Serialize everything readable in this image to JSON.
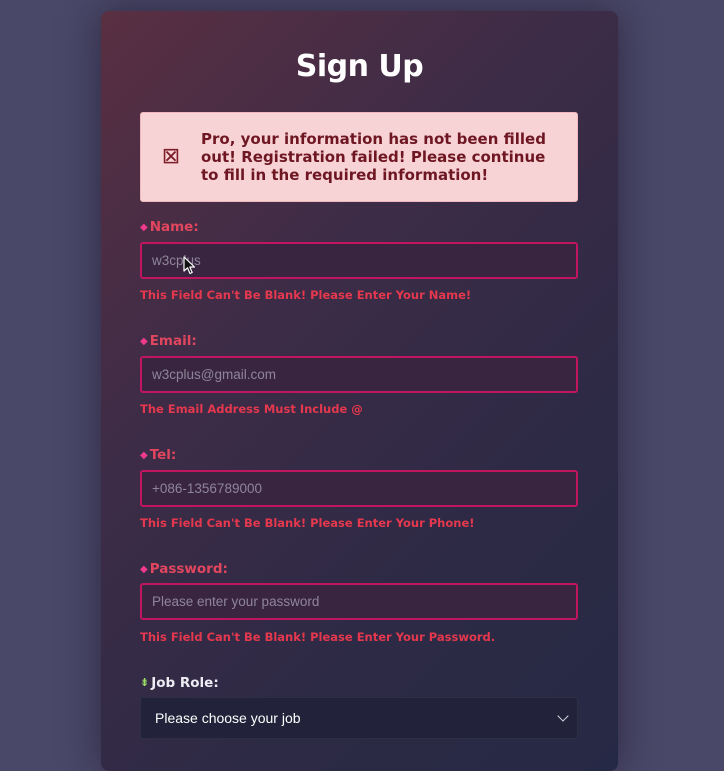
{
  "form": {
    "title": "Sign Up",
    "alert": {
      "icon": "close-box-icon",
      "message": "Pro, your information has not been filled out! Registration failed! Please continue to fill in the required information!"
    },
    "fields": {
      "name": {
        "label": "Name:",
        "marker": "◆",
        "placeholder": "w3cplus",
        "value": "",
        "error": "This Field Can't Be Blank! Please Enter Your Name!"
      },
      "email": {
        "label": "Email:",
        "marker": "◆",
        "placeholder": "w3cplus@gmail.com",
        "value": "",
        "error": "The Email Address Must Include @"
      },
      "tel": {
        "label": "Tel:",
        "marker": "◆",
        "placeholder": "+086-1356789000",
        "value": "",
        "error": "This Field Can't Be Blank! Please Enter Your Phone!"
      },
      "password": {
        "label": "Password:",
        "marker": "◆",
        "placeholder": "Please enter your password",
        "value": "",
        "error": "This Field Can't Be Blank! Please Enter Your Password."
      },
      "job_role": {
        "label": "Job Role:",
        "marker": "⇟",
        "selected": "Please choose your job"
      }
    }
  },
  "colors": {
    "page_background": "#4a4868",
    "error_text": "#e5384e",
    "error_border": "#c2155f",
    "required_marker": "#f03a8c",
    "valid_marker": "#9ce067",
    "alert_background": "#f8d3d5",
    "alert_text": "#6e1723"
  }
}
